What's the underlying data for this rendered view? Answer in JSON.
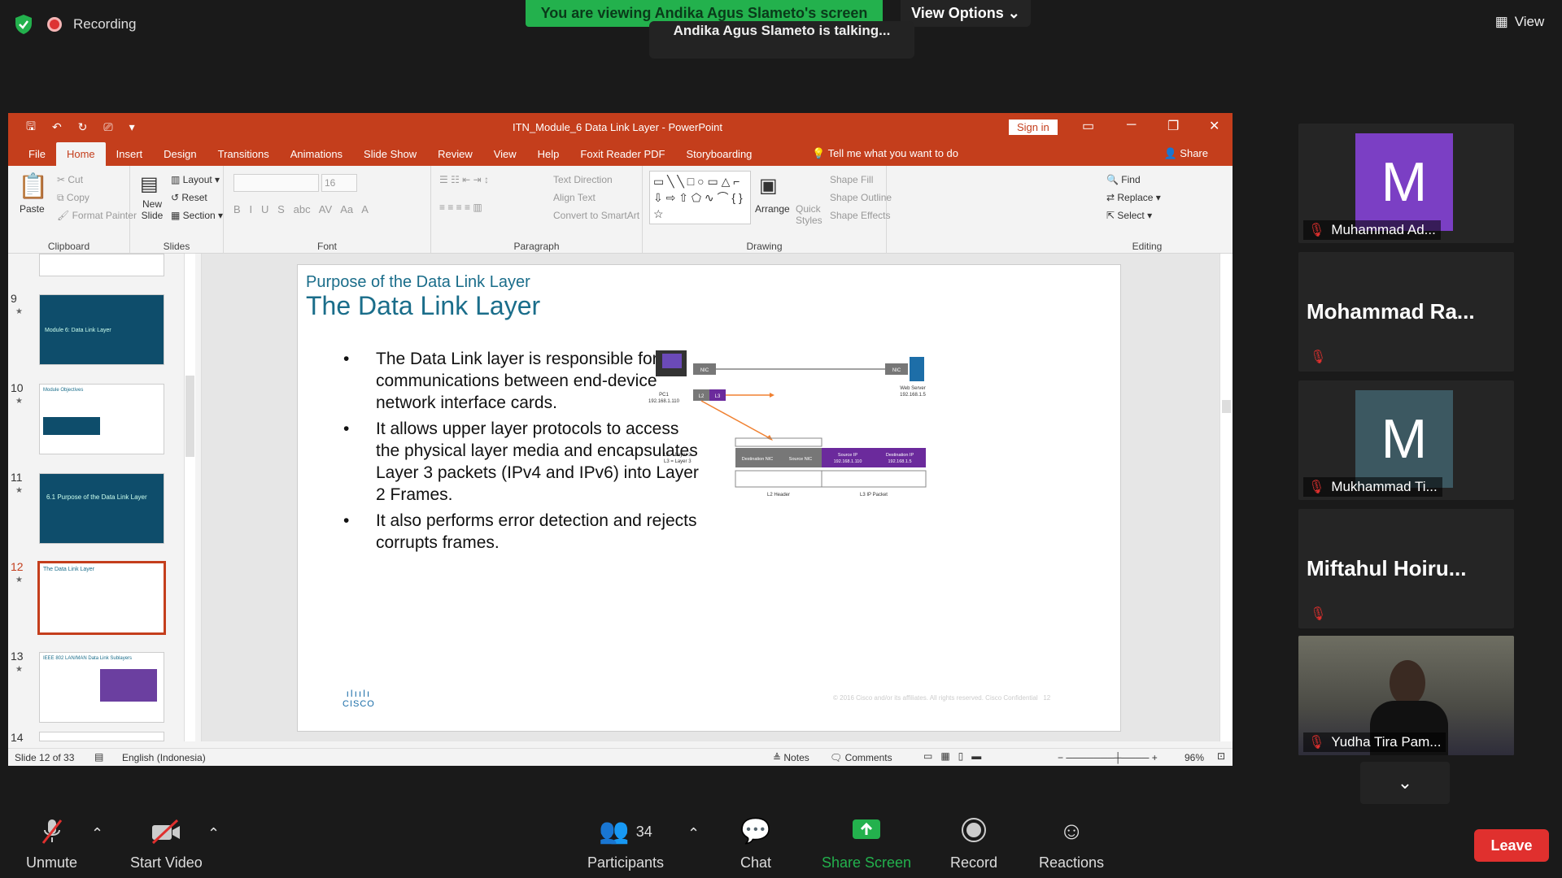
{
  "zoom": {
    "recording_label": "Recording",
    "viewing_banner": "You are viewing Andika Agus Slameto's screen",
    "view_options": "View Options",
    "talking": "Andika Agus Slameto is talking...",
    "view_label": "View",
    "participants_count": "34",
    "controls": {
      "unmute": "Unmute",
      "start_video": "Start Video",
      "participants": "Participants",
      "chat": "Chat",
      "share_screen": "Share Screen",
      "record": "Record",
      "reactions": "Reactions",
      "leave": "Leave"
    },
    "share_color": "#23b14d",
    "leave_color": "#e0302e"
  },
  "participants": [
    {
      "name": "Muhammad Ad...",
      "avatar": "M",
      "avatar_color": "#7b3fc4"
    },
    {
      "name": "Mohammad Ra...",
      "avatar": "",
      "avatar_color": ""
    },
    {
      "name": "Mukhammad Ti...",
      "avatar": "M",
      "avatar_color": "#3c5861"
    },
    {
      "name": "Miftahul Hoiru...",
      "avatar": "",
      "avatar_color": ""
    },
    {
      "name": "Yudha Tira Pam...",
      "avatar": "",
      "avatar_color": ""
    }
  ],
  "ppt": {
    "title": "ITN_Module_6 Data Link Layer  -  PowerPoint",
    "sign_in": "Sign in",
    "tabs": [
      "File",
      "Home",
      "Insert",
      "Design",
      "Transitions",
      "Animations",
      "Slide Show",
      "Review",
      "View",
      "Help",
      "Foxit Reader PDF",
      "Storyboarding"
    ],
    "tell_me": "Tell me what you want to do",
    "share": "Share",
    "ribbon": {
      "clipboard": {
        "label": "Clipboard",
        "paste": "Paste",
        "cut": "Cut",
        "copy": "Copy",
        "format_painter": "Format Painter"
      },
      "slides": {
        "label": "Slides",
        "new_slide": "New Slide",
        "layout": "Layout",
        "reset": "Reset",
        "section": "Section"
      },
      "font": {
        "label": "Font",
        "size": "16"
      },
      "paragraph": {
        "label": "Paragraph",
        "text_direction": "Text Direction",
        "align_text": "Align Text",
        "smartart": "Convert to SmartArt"
      },
      "drawing": {
        "label": "Drawing",
        "arrange": "Arrange",
        "quick_styles": "Quick Styles",
        "shape_fill": "Shape Fill",
        "shape_outline": "Shape Outline",
        "shape_effects": "Shape Effects"
      },
      "editing": {
        "label": "Editing",
        "find": "Find",
        "replace": "Replace",
        "select": "Select"
      }
    },
    "thumbnails": [
      {
        "num": "9",
        "text": "Module 6: Data Link Layer"
      },
      {
        "num": "10",
        "text": "Module Objectives"
      },
      {
        "num": "11",
        "text": "6.1 Purpose of the Data Link Layer"
      },
      {
        "num": "12",
        "text": "The Data Link Layer"
      },
      {
        "num": "13",
        "text": "IEEE 802 LAN/MAN Data Link Sublayers"
      },
      {
        "num": "14",
        "text": ""
      }
    ],
    "slide": {
      "subtitle": "Purpose of the Data Link Layer",
      "title": "The Data Link Layer",
      "bullets": [
        "The Data Link layer is responsible for communications between end-device network interface cards.",
        "It allows upper layer protocols to access the physical layer media and encapsulates Layer 3 packets (IPv4 and IPv6) into Layer 2 Frames.",
        "It also performs error detection and rejects corrupts frames."
      ],
      "diagram": {
        "nic": "NIC",
        "pc_label": "PC1",
        "pc_ip": "192.168.1.110",
        "server_label": "Web Server",
        "server_ip": "192.168.1.5",
        "l2": "L2",
        "l3": "L3",
        "legend_l2": "L2 = Layer 2",
        "legend_l3": "L3 = Layer 3",
        "frame": [
          "Destination NIC",
          "Source NIC",
          "Source IP",
          "Destination IP"
        ],
        "frame_ips": [
          "",
          "",
          "192.168.1.110",
          "192.168.1.5"
        ],
        "l2_header": "L2 Header",
        "l3_packet": "L3 IP Packet"
      },
      "cisco": "CISCO",
      "copyright": "© 2016  Cisco and/or its affiliates. All rights reserved.   Cisco Confidential",
      "page_num": "12"
    },
    "status": {
      "slide_of": "Slide 12 of 33",
      "language": "English (Indonesia)",
      "notes": "Notes",
      "comments": "Comments",
      "zoom": "96%"
    },
    "accent": "#c43e1c"
  }
}
